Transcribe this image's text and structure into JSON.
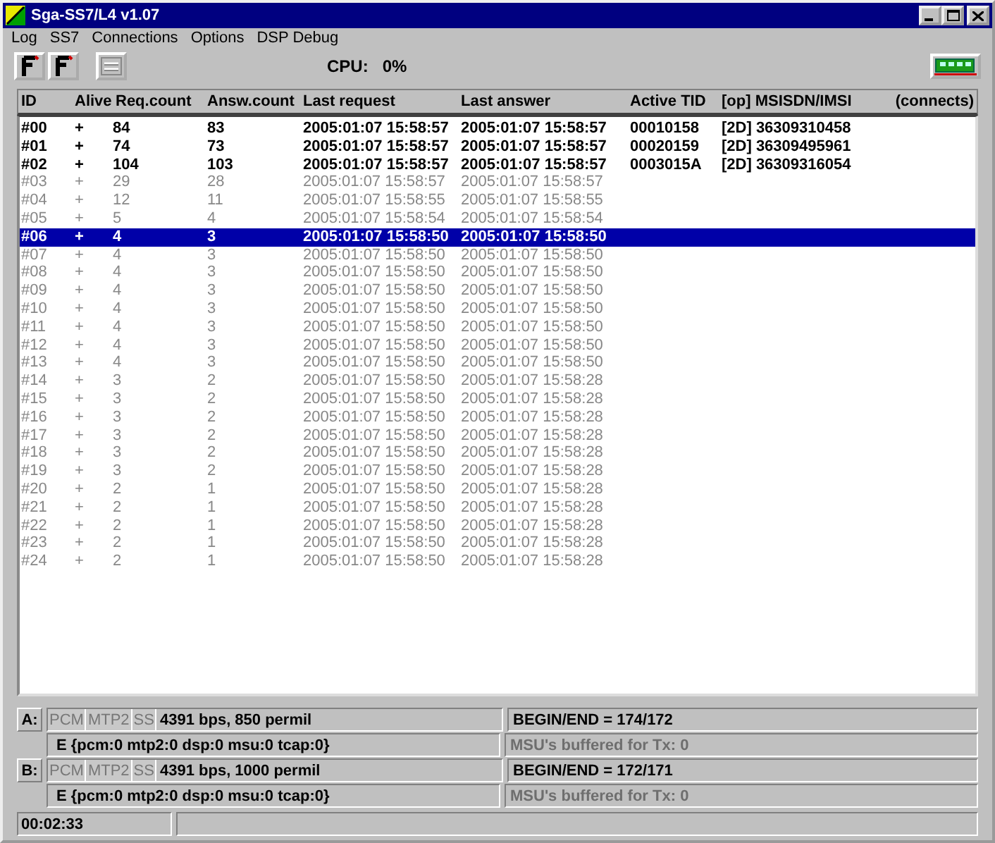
{
  "window": {
    "title": "Sga-SS7/L4  v1.07"
  },
  "menu": [
    "Log",
    "SS7",
    "Connections",
    "Options",
    "DSP Debug"
  ],
  "toolbar": {
    "cpu_label": "CPU:",
    "cpu_value": "0%"
  },
  "table": {
    "columns": [
      "ID",
      "Alive",
      "Req.count",
      "Answ.count",
      "Last request",
      "Last answer",
      "Active TID",
      "[op] MSISDN/IMSI",
      "(connects)"
    ],
    "rows": [
      {
        "id": "#00",
        "alive": "+",
        "req": "84",
        "answ": "83",
        "last_request": "2005:01:07 15:58:57",
        "last_answer": "2005:01:07 15:58:57",
        "tid": "00010158",
        "msisdn": "[2D] 36309310458",
        "active": true,
        "selected": false
      },
      {
        "id": "#01",
        "alive": "+",
        "req": "74",
        "answ": "73",
        "last_request": "2005:01:07 15:58:57",
        "last_answer": "2005:01:07 15:58:57",
        "tid": "00020159",
        "msisdn": "[2D] 36309495961",
        "active": true,
        "selected": false
      },
      {
        "id": "#02",
        "alive": "+",
        "req": "104",
        "answ": "103",
        "last_request": "2005:01:07 15:58:57",
        "last_answer": "2005:01:07 15:58:57",
        "tid": "0003015A",
        "msisdn": "[2D] 36309316054",
        "active": true,
        "selected": false
      },
      {
        "id": "#03",
        "alive": "+",
        "req": "29",
        "answ": "28",
        "last_request": "2005:01:07 15:58:57",
        "last_answer": "2005:01:07 15:58:57",
        "active": false,
        "selected": false
      },
      {
        "id": "#04",
        "alive": "+",
        "req": "12",
        "answ": "11",
        "last_request": "2005:01:07 15:58:55",
        "last_answer": "2005:01:07 15:58:55",
        "active": false,
        "selected": false
      },
      {
        "id": "#05",
        "alive": "+",
        "req": "5",
        "answ": "4",
        "last_request": "2005:01:07 15:58:54",
        "last_answer": "2005:01:07 15:58:54",
        "active": false,
        "selected": false
      },
      {
        "id": "#06",
        "alive": "+",
        "req": "4",
        "answ": "3",
        "last_request": "2005:01:07 15:58:50",
        "last_answer": "2005:01:07 15:58:50",
        "active": false,
        "selected": true
      },
      {
        "id": "#07",
        "alive": "+",
        "req": "4",
        "answ": "3",
        "last_request": "2005:01:07 15:58:50",
        "last_answer": "2005:01:07 15:58:50",
        "active": false,
        "selected": false
      },
      {
        "id": "#08",
        "alive": "+",
        "req": "4",
        "answ": "3",
        "last_request": "2005:01:07 15:58:50",
        "last_answer": "2005:01:07 15:58:50",
        "active": false,
        "selected": false
      },
      {
        "id": "#09",
        "alive": "+",
        "req": "4",
        "answ": "3",
        "last_request": "2005:01:07 15:58:50",
        "last_answer": "2005:01:07 15:58:50",
        "active": false,
        "selected": false
      },
      {
        "id": "#10",
        "alive": "+",
        "req": "4",
        "answ": "3",
        "last_request": "2005:01:07 15:58:50",
        "last_answer": "2005:01:07 15:58:50",
        "active": false,
        "selected": false
      },
      {
        "id": "#11",
        "alive": "+",
        "req": "4",
        "answ": "3",
        "last_request": "2005:01:07 15:58:50",
        "last_answer": "2005:01:07 15:58:50",
        "active": false,
        "selected": false
      },
      {
        "id": "#12",
        "alive": "+",
        "req": "4",
        "answ": "3",
        "last_request": "2005:01:07 15:58:50",
        "last_answer": "2005:01:07 15:58:50",
        "active": false,
        "selected": false
      },
      {
        "id": "#13",
        "alive": "+",
        "req": "4",
        "answ": "3",
        "last_request": "2005:01:07 15:58:50",
        "last_answer": "2005:01:07 15:58:50",
        "active": false,
        "selected": false
      },
      {
        "id": "#14",
        "alive": "+",
        "req": "3",
        "answ": "2",
        "last_request": "2005:01:07 15:58:50",
        "last_answer": "2005:01:07 15:58:28",
        "active": false,
        "selected": false
      },
      {
        "id": "#15",
        "alive": "+",
        "req": "3",
        "answ": "2",
        "last_request": "2005:01:07 15:58:50",
        "last_answer": "2005:01:07 15:58:28",
        "active": false,
        "selected": false
      },
      {
        "id": "#16",
        "alive": "+",
        "req": "3",
        "answ": "2",
        "last_request": "2005:01:07 15:58:50",
        "last_answer": "2005:01:07 15:58:28",
        "active": false,
        "selected": false
      },
      {
        "id": "#17",
        "alive": "+",
        "req": "3",
        "answ": "2",
        "last_request": "2005:01:07 15:58:50",
        "last_answer": "2005:01:07 15:58:28",
        "active": false,
        "selected": false
      },
      {
        "id": "#18",
        "alive": "+",
        "req": "3",
        "answ": "2",
        "last_request": "2005:01:07 15:58:50",
        "last_answer": "2005:01:07 15:58:28",
        "active": false,
        "selected": false
      },
      {
        "id": "#19",
        "alive": "+",
        "req": "3",
        "answ": "2",
        "last_request": "2005:01:07 15:58:50",
        "last_answer": "2005:01:07 15:58:28",
        "active": false,
        "selected": false
      },
      {
        "id": "#20",
        "alive": "+",
        "req": "2",
        "answ": "1",
        "last_request": "2005:01:07 15:58:50",
        "last_answer": "2005:01:07 15:58:28",
        "active": false,
        "selected": false
      },
      {
        "id": "#21",
        "alive": "+",
        "req": "2",
        "answ": "1",
        "last_request": "2005:01:07 15:58:50",
        "last_answer": "2005:01:07 15:58:28",
        "active": false,
        "selected": false
      },
      {
        "id": "#22",
        "alive": "+",
        "req": "2",
        "answ": "1",
        "last_request": "2005:01:07 15:58:50",
        "last_answer": "2005:01:07 15:58:28",
        "active": false,
        "selected": false
      },
      {
        "id": "#23",
        "alive": "+",
        "req": "2",
        "answ": "1",
        "last_request": "2005:01:07 15:58:50",
        "last_answer": "2005:01:07 15:58:28",
        "active": false,
        "selected": false
      },
      {
        "id": "#24",
        "alive": "+",
        "req": "2",
        "answ": "1",
        "last_request": "2005:01:07 15:58:50",
        "last_answer": "2005:01:07 15:58:28",
        "active": false,
        "selected": false
      }
    ]
  },
  "links": [
    {
      "label": "A:",
      "indicators": [
        {
          "text": "PCM",
          "on": false
        },
        {
          "text": "MTP2",
          "on": false
        },
        {
          "text": "SS",
          "on": false
        }
      ],
      "rate": "4391 bps, 850 permil",
      "begin_end": "BEGIN/END = 174/172",
      "errors": "E {pcm:0  mtp2:0  dsp:0  msu:0  tcap:0}",
      "buffered": {
        "text": "MSU's buffered for Tx: 0",
        "disabled": true
      }
    },
    {
      "label": "B:",
      "indicators": [
        {
          "text": "PCM",
          "on": false
        },
        {
          "text": "MTP2",
          "on": false
        },
        {
          "text": "SS",
          "on": false
        }
      ],
      "rate": "4391 bps, 1000 permil",
      "begin_end": "BEGIN/END = 172/171",
      "errors": "E {pcm:0  mtp2:0  dsp:0  msu:0  tcap:0}",
      "buffered": {
        "text": "MSU's buffered for Tx: 0",
        "disabled": true
      }
    }
  ],
  "status_bar": {
    "time": "00:02:33"
  }
}
